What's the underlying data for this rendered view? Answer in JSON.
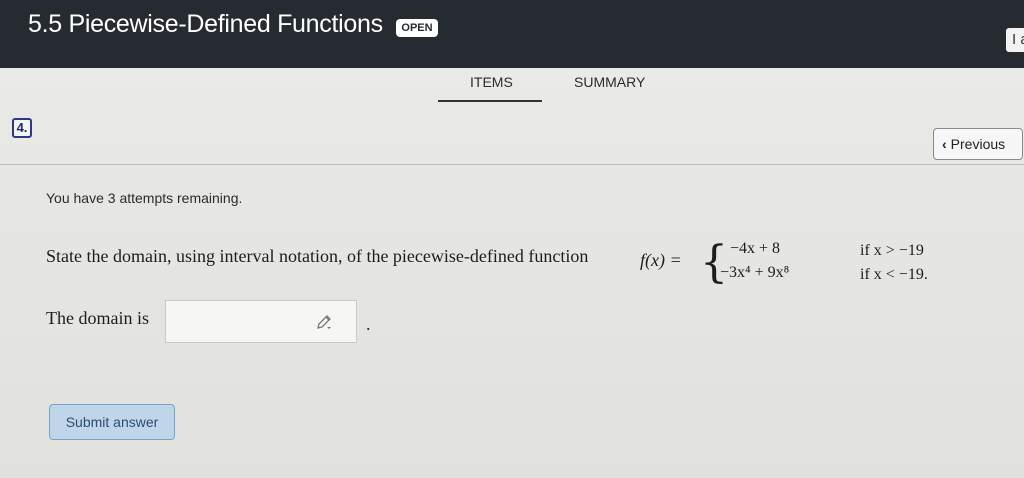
{
  "header": {
    "title": "5.5 Piecewise-Defined Functions",
    "badge": "OPEN",
    "right_fragment": "I a"
  },
  "tabs": [
    {
      "label": "ITEMS",
      "active": true
    },
    {
      "label": "SUMMARY",
      "active": false
    }
  ],
  "question": {
    "number": "4.",
    "previous_label": "Previous",
    "attempts_text": "You have 3 attempts remaining.",
    "prompt": "State the domain, using interval notation, of the piecewise-defined function",
    "function_name": "f(x) =",
    "pieces": [
      {
        "expr_html": "−4x + 8",
        "condition": "if x > −19"
      },
      {
        "expr_html": "−3x⁴ + 9x⁸",
        "condition": "if x < −19."
      }
    ],
    "domain_label": "The domain is",
    "domain_value": "",
    "trailing_period": ".",
    "submit_label": "Submit answer"
  },
  "colors": {
    "header_bg": "#262a31",
    "submit_bg": "#bfd6ea",
    "qnum_border": "#2a3b7a"
  }
}
